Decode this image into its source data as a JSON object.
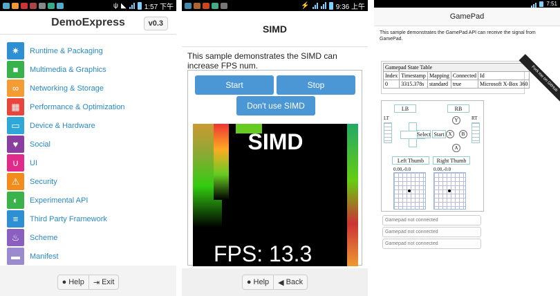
{
  "panel1": {
    "status_time": "1:57 下午",
    "title": "DemoExpress",
    "version": "v0.3",
    "items": [
      {
        "label": "Runtime & Packaging",
        "color": "#2d8fd4",
        "icon": "gear-icon"
      },
      {
        "label": "Multimedia & Graphics",
        "color": "#38b24a",
        "icon": "camera-icon"
      },
      {
        "label": "Networking & Storage",
        "color": "#f39c33",
        "icon": "network-icon"
      },
      {
        "label": "Performance & Optimization",
        "color": "#e8453c",
        "icon": "grid-icon"
      },
      {
        "label": "Device & Hardware",
        "color": "#2fa8d8",
        "icon": "device-icon"
      },
      {
        "label": "Social",
        "color": "#8a3fa0",
        "icon": "heart-icon"
      },
      {
        "label": "UI",
        "color": "#e02b8a",
        "icon": "magnet-icon"
      },
      {
        "label": "Security",
        "color": "#f28c1c",
        "icon": "warning-icon"
      },
      {
        "label": "Experimental API",
        "color": "#3bb34a",
        "icon": "contrast-icon"
      },
      {
        "label": "Third Party Framework",
        "color": "#2d8fd4",
        "icon": "stack-icon"
      },
      {
        "label": "Scheme",
        "color": "#8a5fc0",
        "icon": "flame-icon"
      },
      {
        "label": "Manifest",
        "color": "#9b8ad0",
        "icon": "folder-icon"
      }
    ],
    "help": "Help",
    "exit": "Exit"
  },
  "panel2": {
    "status_time": "9:36 上午",
    "title": "SIMD",
    "description": "This sample demonstrates the SIMD can increase FPS num.",
    "start": "Start",
    "stop": "Stop",
    "dont_use": "Don't use SIMD",
    "canvas_label": "SIMD",
    "fps": "FPS: 13.3",
    "help": "Help",
    "back": "Back"
  },
  "panel3": {
    "status_time": "7:51",
    "title": "GamePad",
    "description": "This sample demonstrates the GamePad API can receive the signal from GamePad.",
    "table_caption": "Gamepad State Table",
    "headers": [
      "Index",
      "Timestamp",
      "Mapping",
      "Connected",
      "Id"
    ],
    "row": [
      "0",
      "3315.378s",
      "standard",
      "true",
      "Microsoft X-Box 360"
    ],
    "ribbon": "Fork me on GitHub",
    "lb": "LB",
    "rb": "RB",
    "lt": "LT",
    "rt": "RT",
    "select": "Select",
    "start": "Start",
    "y": "Y",
    "x": "X",
    "b": "B",
    "a": "A",
    "left_thumb": "Left Thumb",
    "right_thumb": "Right Thumb",
    "left_val": "0.00,-0.0",
    "right_val": "0.00,-0.0",
    "not_connected": [
      "Gamepad not connected",
      "Gamepad not connected",
      "Gamepad not connected"
    ]
  }
}
